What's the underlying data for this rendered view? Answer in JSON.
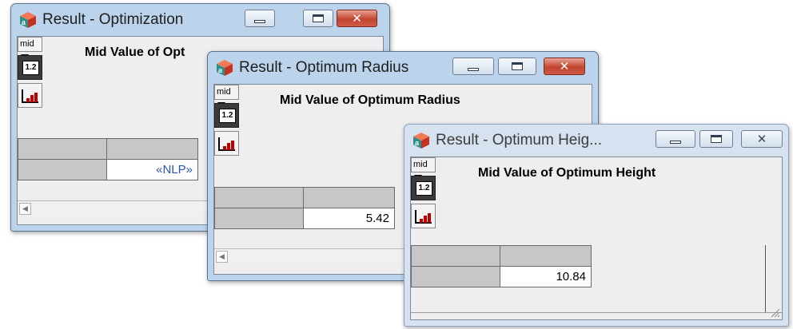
{
  "windows": [
    {
      "title": "Result - Optimization",
      "heading": "Mid Value of Opt",
      "mid_label": "mid",
      "table_button_label": "1.2",
      "cell_value": "«NLP»"
    },
    {
      "title": "Result - Optimum Radius",
      "heading": "Mid Value of Optimum Radius",
      "mid_label": "mid",
      "table_button_label": "1.2",
      "cell_value": "5.42"
    },
    {
      "title": "Result - Optimum Heig...",
      "heading": "Mid Value of Optimum Height",
      "mid_label": "mid",
      "table_button_label": "1.2",
      "cell_value": "10.84"
    }
  ],
  "colors": {
    "title_bar": "#bcd3ec",
    "close_button": "#c24530",
    "grid_header": "#c7c7c7",
    "nlp_text": "#2a52b8"
  },
  "icons": [
    "app-cube-icon",
    "minimize-icon",
    "maximize-icon",
    "close-icon",
    "dropdown-triangle-icon",
    "table-view-icon",
    "graph-view-icon",
    "scroll-left-arrow-icon",
    "resize-grip-icon"
  ]
}
